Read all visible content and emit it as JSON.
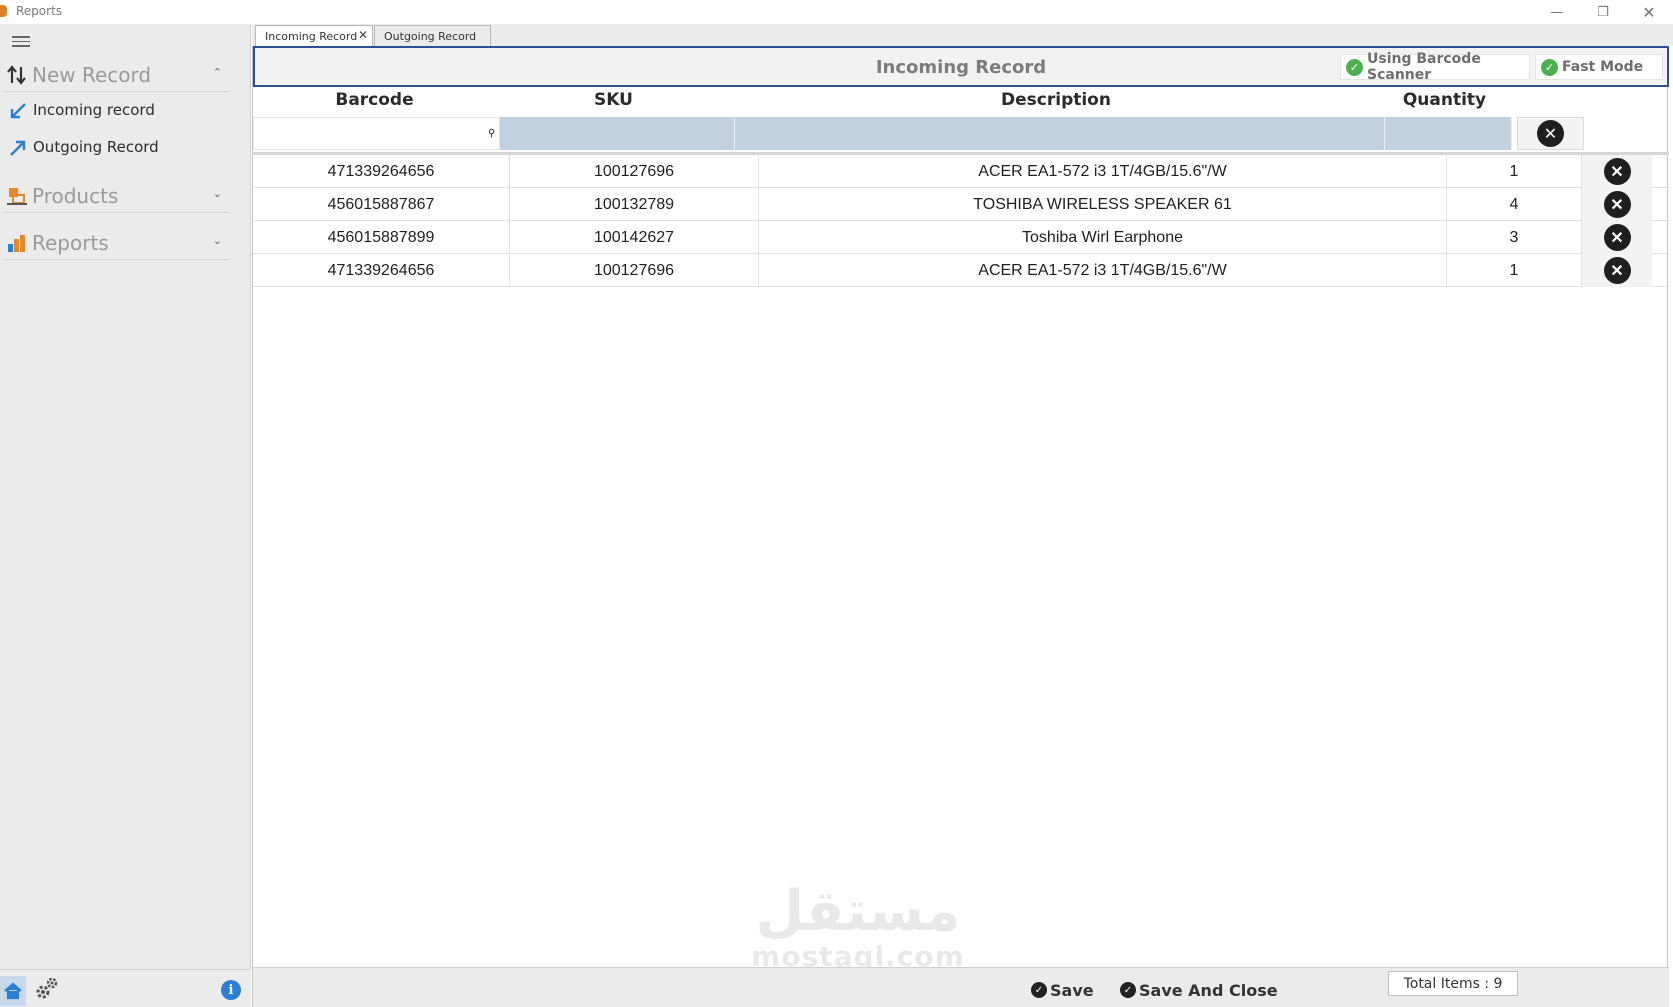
{
  "window": {
    "title": "Reports",
    "min_icon": "minimize-icon",
    "max_icon": "restore-icon",
    "close_icon": "close-icon"
  },
  "sidebar": {
    "groups": [
      {
        "label": "New Record",
        "icon": "sort-arrows-icon",
        "expanded": true
      },
      {
        "label": "Products",
        "icon": "products-icon",
        "expanded": false
      },
      {
        "label": "Reports",
        "icon": "bar-chart-icon",
        "expanded": false
      }
    ],
    "items": [
      {
        "label": "Incoming record",
        "icon": "arrow-down-left-icon"
      },
      {
        "label": "Outgoing Record",
        "icon": "arrow-up-right-icon"
      }
    ]
  },
  "tabs": [
    {
      "label": "Incoming Record",
      "active": true
    },
    {
      "label": "Outgoing Record",
      "active": false
    }
  ],
  "panel": {
    "title": "Incoming Record",
    "toggles": [
      {
        "label": "Using Barcode Scanner",
        "checked": true
      },
      {
        "label": "Fast Mode",
        "checked": true
      }
    ]
  },
  "table": {
    "columns": [
      "Barcode",
      "SKU",
      "Description",
      "Quantity"
    ],
    "filter": {
      "barcode": ""
    },
    "rows": [
      {
        "barcode": "471339264656",
        "sku": "100127696",
        "description": "ACER EA1-572 i3 1T/4GB/15.6\"/W",
        "quantity": "1"
      },
      {
        "barcode": "456015887867",
        "sku": "100132789",
        "description": "TOSHIBA WIRELESS SPEAKER 61",
        "quantity": "4"
      },
      {
        "barcode": "456015887899",
        "sku": "100142627",
        "description": "Toshiba Wirl Earphone",
        "quantity": "3"
      },
      {
        "barcode": "471339264656",
        "sku": "100127696",
        "description": "ACER EA1-572 i3 1T/4GB/15.6\"/W",
        "quantity": "1"
      }
    ]
  },
  "footer": {
    "save_label": "Save",
    "save_close_label": "Save And Close",
    "total_label": "Total Items  : 9"
  },
  "watermark": {
    "arabic": "مستقل",
    "latin": "mostaql.com"
  },
  "colors": {
    "accent_border": "#2f4f8f",
    "filter_fill": "#c2d1df",
    "check_green": "#4caf50",
    "icon_blue": "#2a7fd4",
    "icon_orange": "#e08a2c"
  }
}
